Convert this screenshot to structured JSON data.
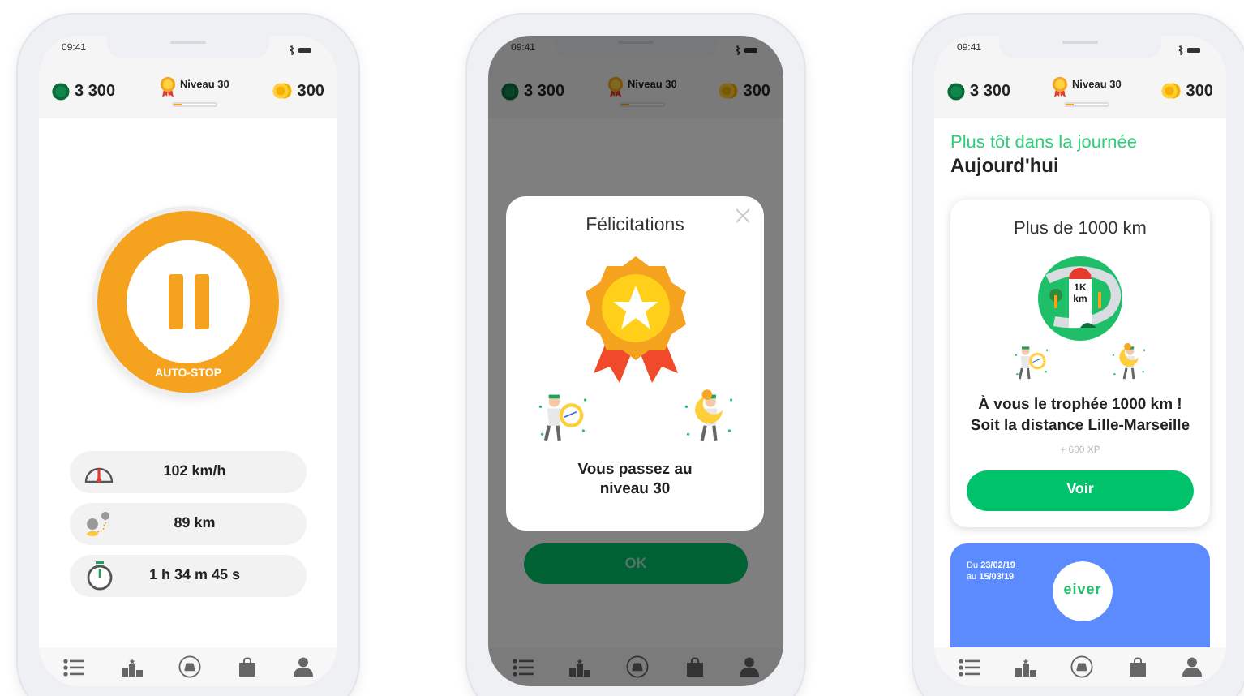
{
  "phones": [
    {
      "kind": "drive",
      "status_bar": {
        "time": "09:41"
      },
      "header": {
        "xp": "3 300",
        "level_label": "Niveau 30",
        "level": 0.2,
        "coins": "300"
      },
      "autostop": {
        "label": "AUTO-STOP"
      },
      "stats": [
        {
          "kind": "speed",
          "value": "102 km/h"
        },
        {
          "kind": "distance",
          "value": "89 km"
        },
        {
          "kind": "duration",
          "value": "1 h 34 m 45 s"
        }
      ]
    },
    {
      "kind": "modal",
      "status_bar": {
        "time": "09:41"
      },
      "header": {
        "xp": "3 300",
        "level_label": "Niveau 30",
        "level": 0.2,
        "coins": "300"
      },
      "modal": {
        "title": "Félicitations",
        "message": "Vous passez au niveau 30"
      },
      "button": "OK"
    },
    {
      "kind": "feed",
      "status_bar": {
        "time": "09:41"
      },
      "header": {
        "xp": "3 300",
        "level_label": "Niveau 30",
        "level": 0.2,
        "coins": "300"
      },
      "section_label": "Plus tôt dans la journée",
      "heading": "Aujourd'hui",
      "card": {
        "title": "Plus de 1000 km",
        "milestone_label": "1K km",
        "message_lines": [
          "À vous le trophée 1000 km !",
          "Soit la distance Lille-Marseille"
        ],
        "reward": "+ 600 XP",
        "button": "Voir"
      },
      "promo": {
        "dates": [
          "Du **23/02/19**",
          "au **15/03/19**"
        ],
        "logo": "eiver"
      }
    }
  ]
}
